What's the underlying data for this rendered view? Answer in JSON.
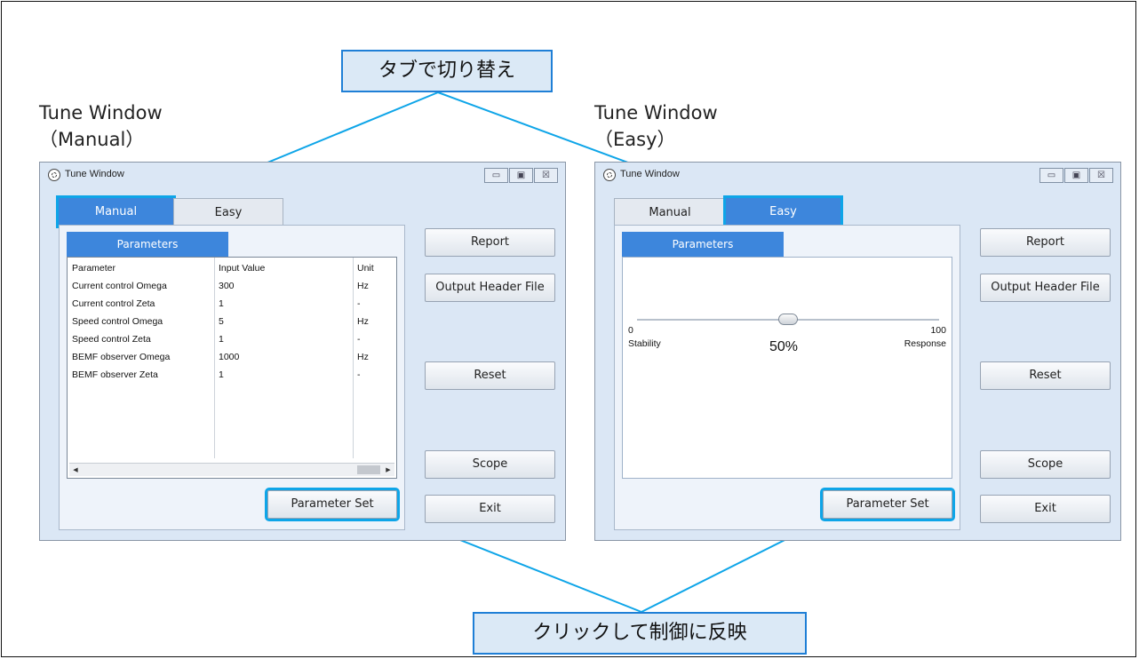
{
  "callouts": {
    "top": "タブで切り替え",
    "bottom": "クリックして制御に反映"
  },
  "headings": {
    "left": {
      "line1": "Tune Window",
      "line2": "（Manual）"
    },
    "right": {
      "line1": "Tune Window",
      "line2": "（Easy）"
    }
  },
  "window": {
    "title": "Tune Window",
    "controls": {
      "minimize": "▭",
      "maximize": "▣",
      "close": "☒"
    }
  },
  "tabs": {
    "manual": "Manual",
    "easy": "Easy"
  },
  "subtab": "Parameters",
  "table": {
    "headers": [
      "Parameter",
      "Input Value",
      "Unit"
    ],
    "rows": [
      [
        "Current control Omega",
        "300",
        "Hz"
      ],
      [
        "Current control Zeta",
        "1",
        "-"
      ],
      [
        "Speed control Omega",
        "5",
        "Hz"
      ],
      [
        "Speed control Zeta",
        "1",
        "-"
      ],
      [
        "BEMF observer Omega",
        "1000",
        "Hz"
      ],
      [
        "BEMF observer Zeta",
        "1",
        "-"
      ]
    ]
  },
  "buttons": {
    "report": "Report",
    "output_header": "Output Header File",
    "reset": "Reset",
    "scope": "Scope",
    "exit": "Exit",
    "parameter_set": "Parameter Set"
  },
  "slider": {
    "min_label": "0",
    "max_label": "100",
    "left_caption": "Stability",
    "right_caption": "Response",
    "value_label": "50%",
    "value_fraction": 0.5
  },
  "colors": {
    "accent": "#3d86dc",
    "highlight": "#0ea5e8",
    "callout_bg": "#dbe9f6"
  }
}
